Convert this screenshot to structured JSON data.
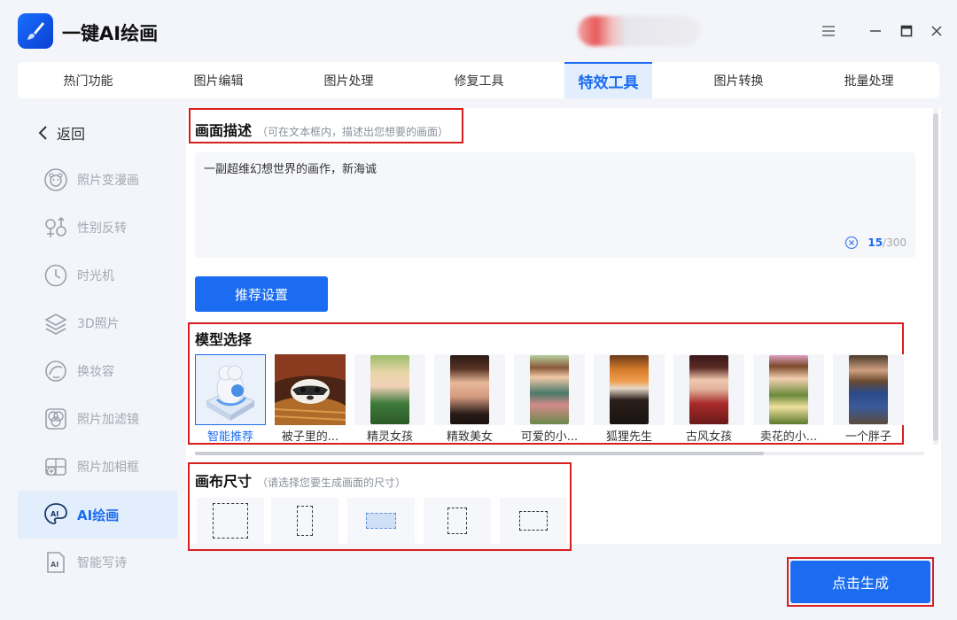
{
  "app": {
    "title": "一键AI绘画"
  },
  "tabs": [
    {
      "label": "热门功能",
      "active": false
    },
    {
      "label": "图片编辑",
      "active": false
    },
    {
      "label": "图片处理",
      "active": false
    },
    {
      "label": "修复工具",
      "active": false
    },
    {
      "label": "特效工具",
      "active": true
    },
    {
      "label": "图片转换",
      "active": false
    },
    {
      "label": "批量处理",
      "active": false
    }
  ],
  "sidebar": {
    "back_label": "返回",
    "items": [
      {
        "label": "照片变漫画",
        "icon": "cartoon-face-icon",
        "active": false
      },
      {
        "label": "性别反转",
        "icon": "gender-icon",
        "active": false
      },
      {
        "label": "时光机",
        "icon": "clock-icon",
        "active": false
      },
      {
        "label": "3D照片",
        "icon": "layers-icon",
        "active": false
      },
      {
        "label": "换妆容",
        "icon": "makeup-face-icon",
        "active": false
      },
      {
        "label": "照片加滤镜",
        "icon": "filter-icon",
        "active": false
      },
      {
        "label": "照片加相框",
        "icon": "frame-add-icon",
        "active": false
      },
      {
        "label": "AI绘画",
        "icon": "ai-paint-icon",
        "active": true
      },
      {
        "label": "智能写诗",
        "icon": "ai-doc-icon",
        "active": false
      }
    ]
  },
  "description": {
    "title": "画面描述",
    "hint": "（可在文本框内，描述出您想要的画面）",
    "text": "一副超维幻想世界的画作，新海诚",
    "count": "15",
    "max": "/300"
  },
  "recommend_button": "推荐设置",
  "models": {
    "title": "模型选择",
    "items": [
      {
        "label": "智能推荐",
        "selected": true
      },
      {
        "label": "被子里的...",
        "selected": false
      },
      {
        "label": "精灵女孩",
        "selected": false
      },
      {
        "label": "精致美女",
        "selected": false
      },
      {
        "label": "可爱的小...",
        "selected": false
      },
      {
        "label": "狐狸先生",
        "selected": false
      },
      {
        "label": "古风女孩",
        "selected": false
      },
      {
        "label": "卖花的小...",
        "selected": false
      },
      {
        "label": "一个胖子",
        "selected": false
      }
    ]
  },
  "canvas": {
    "title": "画布尺寸",
    "hint": "（请选择您要生成画面的尺寸）",
    "selected_index": 2
  },
  "generate_button": "点击生成",
  "colors": {
    "accent": "#1b6cf0",
    "highlight": "#d71f1f",
    "active_bg": "#e3eefc"
  }
}
